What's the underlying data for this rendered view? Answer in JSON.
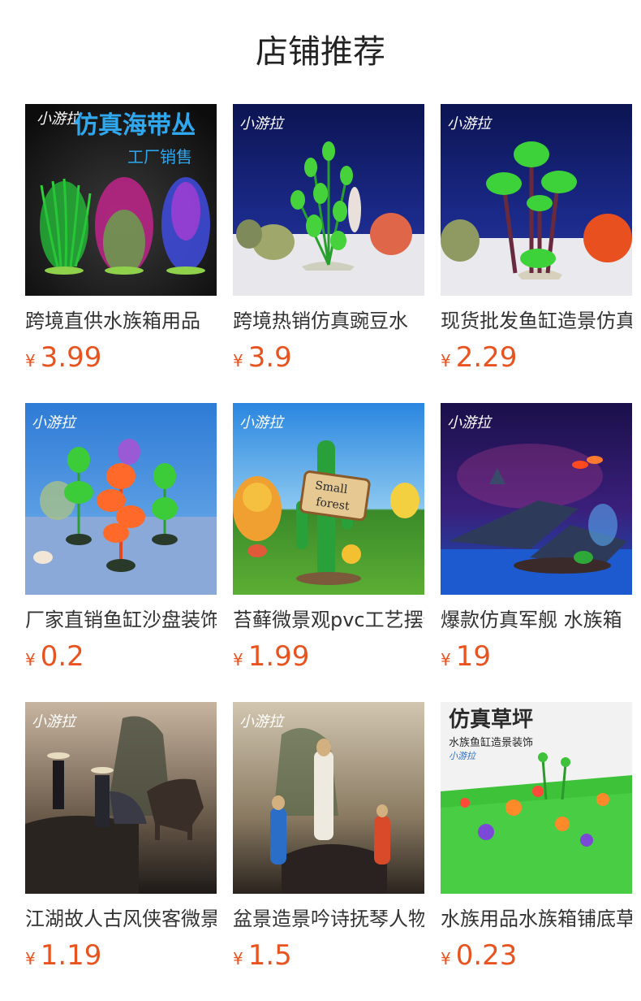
{
  "section": {
    "title": "店铺推荐"
  },
  "products": [
    {
      "name": "跨境直供水族箱用品",
      "currency": "¥",
      "price": "3.99",
      "image": {
        "icon": "seaweed-plants-image",
        "brand": "小游拉",
        "headline": "仿真海带丛",
        "subline": "工厂销售"
      }
    },
    {
      "name": "跨境热销仿真豌豆水",
      "currency": "¥",
      "price": "3.9",
      "image": {
        "icon": "aquarium-plant-image",
        "brand": "小游拉"
      }
    },
    {
      "name": "现货批发鱼缸造景仿真",
      "currency": "¥",
      "price": "2.29",
      "image": {
        "icon": "palm-tree-plant-image",
        "brand": "小游拉"
      }
    },
    {
      "name": "厂家直销鱼缸沙盘装饰",
      "currency": "¥",
      "price": "0.2",
      "image": {
        "icon": "colorful-plants-image",
        "brand": "小游拉"
      }
    },
    {
      "name": "苔藓微景观pvc工艺摆件",
      "currency": "¥",
      "price": "1.99",
      "image": {
        "icon": "cactus-sign-image",
        "brand": "小游拉",
        "sign_line1": "Small",
        "sign_line2": "forest"
      }
    },
    {
      "name": "爆款仿真军舰 水族箱",
      "currency": "¥",
      "price": "19",
      "image": {
        "icon": "shipwreck-image",
        "brand": "小游拉"
      }
    },
    {
      "name": "江湖故人古风侠客微景观",
      "currency": "¥",
      "price": "1.19",
      "image": {
        "icon": "swordsman-figurines-image",
        "brand": "小游拉"
      }
    },
    {
      "name": "盆景造景吟诗抚琴人物",
      "currency": "¥",
      "price": "1.5",
      "image": {
        "icon": "scholar-figurines-image",
        "brand": "小游拉"
      }
    },
    {
      "name": "水族用品水族箱铺底草坪",
      "currency": "¥",
      "price": "0.23",
      "image": {
        "icon": "artificial-lawn-image",
        "brand": "小游拉",
        "headline": "仿真草坪",
        "subline": "水族鱼缸造景装饰"
      }
    }
  ],
  "colors": {
    "price": "#e8531f",
    "title": "#222222",
    "name": "#333333"
  }
}
